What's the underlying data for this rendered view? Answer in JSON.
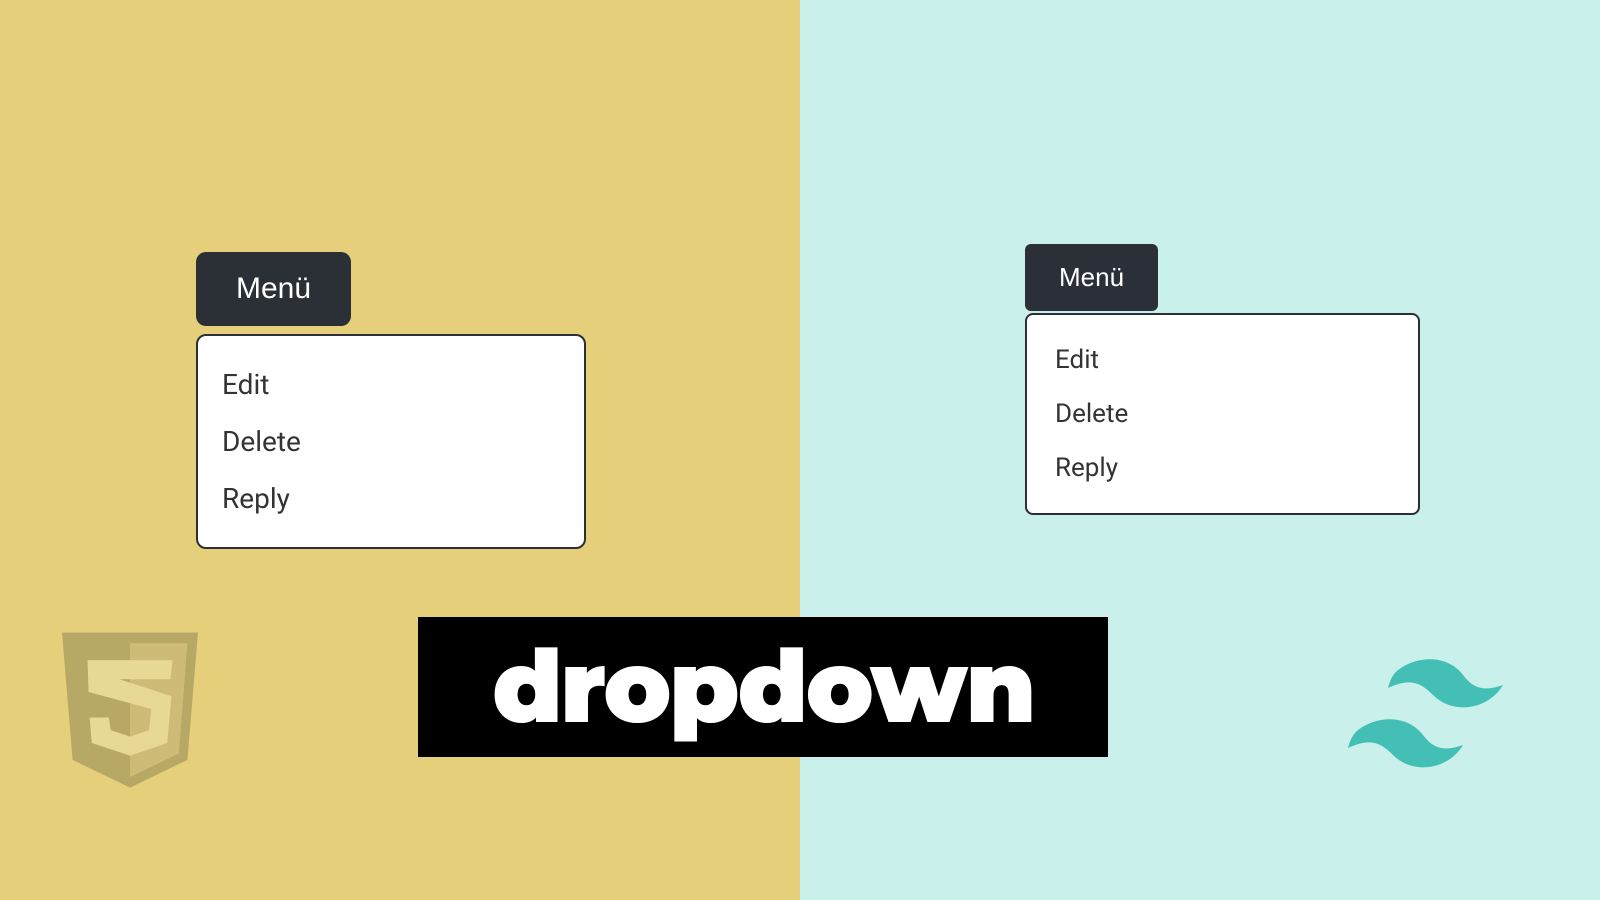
{
  "left": {
    "button_label": "Menü",
    "items": [
      "Edit",
      "Delete",
      "Reply"
    ]
  },
  "right": {
    "button_label": "Menü",
    "items": [
      "Edit",
      "Delete",
      "Reply"
    ]
  },
  "banner": "dropdown",
  "colors": {
    "left_bg": "#e5cf7b",
    "right_bg": "#caf0ec",
    "button_bg": "#2b2f36",
    "tailwind": "#44bfb5"
  }
}
